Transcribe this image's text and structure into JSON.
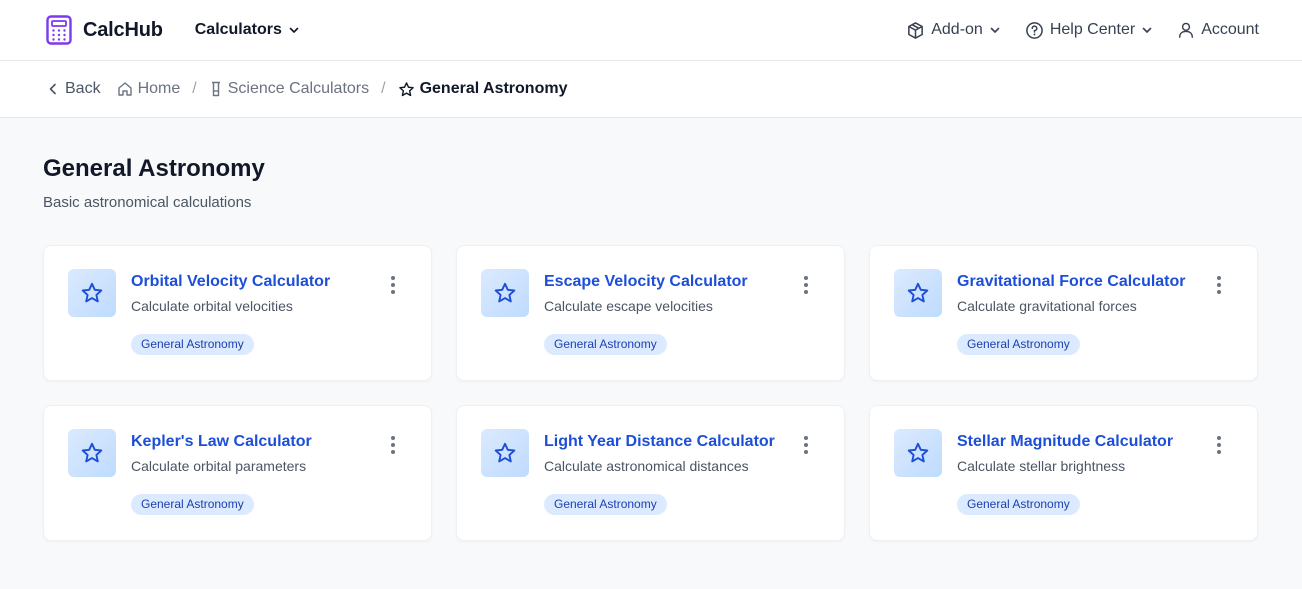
{
  "header": {
    "brand": "CalcHub",
    "calculators_label": "Calculators",
    "addon_label": "Add-on",
    "help_label": "Help Center",
    "account_label": "Account"
  },
  "breadcrumb": {
    "back": "Back",
    "home": "Home",
    "science": "Science Calculators",
    "current": "General Astronomy"
  },
  "page": {
    "title": "General Astronomy",
    "subtitle": "Basic astronomical calculations"
  },
  "cards": [
    {
      "title": "Orbital Velocity Calculator",
      "desc": "Calculate orbital velocities",
      "tag": "General Astronomy"
    },
    {
      "title": "Escape Velocity Calculator",
      "desc": "Calculate escape velocities",
      "tag": "General Astronomy"
    },
    {
      "title": "Gravitational Force Calculator",
      "desc": "Calculate gravitational forces",
      "tag": "General Astronomy"
    },
    {
      "title": "Kepler's Law Calculator",
      "desc": "Calculate orbital parameters",
      "tag": "General Astronomy"
    },
    {
      "title": "Light Year Distance Calculator",
      "desc": "Calculate astronomical distances",
      "tag": "General Astronomy"
    },
    {
      "title": "Stellar Magnitude Calculator",
      "desc": "Calculate stellar brightness",
      "tag": "General Astronomy"
    }
  ],
  "colors": {
    "brand_purple": "#7c3aed",
    "link_blue": "#1d4ed8",
    "tag_bg": "#dbeafe"
  }
}
